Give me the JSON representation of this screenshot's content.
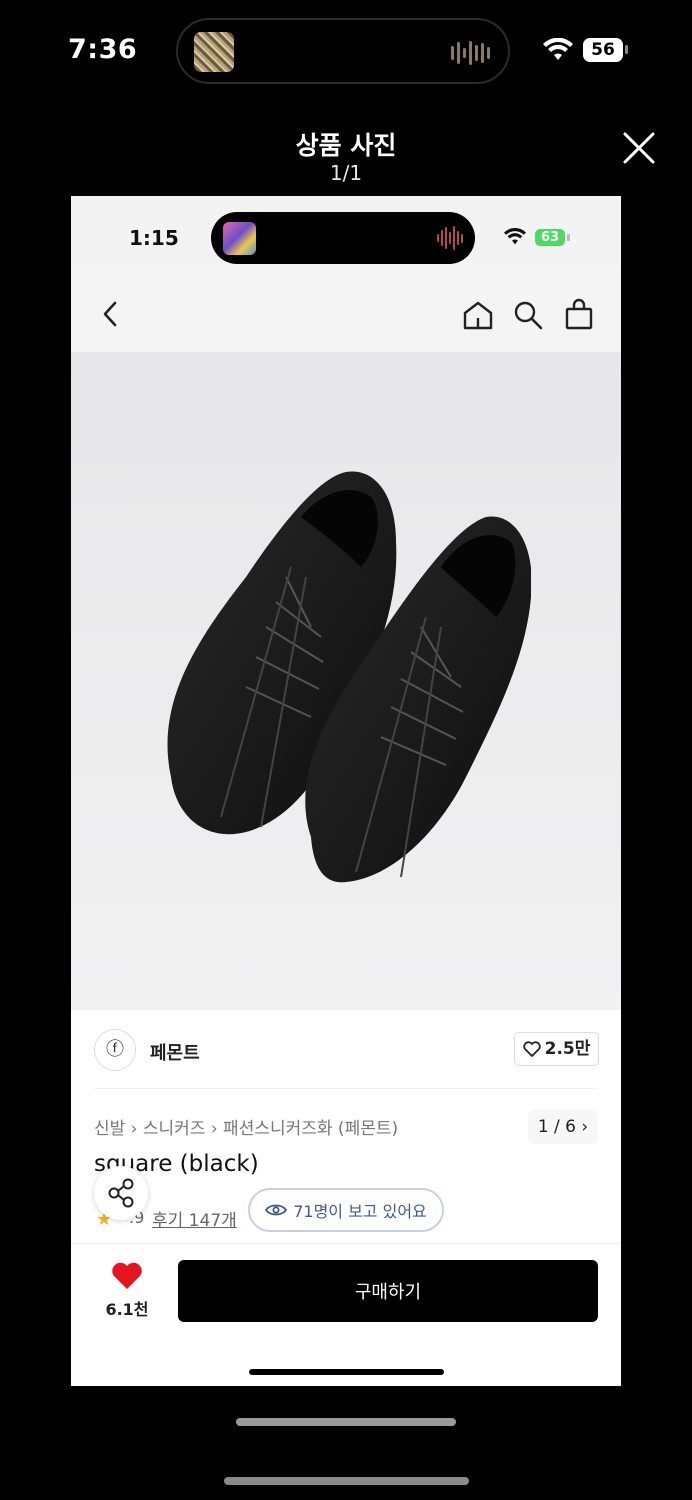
{
  "status_bar": {
    "time": "7:36",
    "battery": "56"
  },
  "viewer": {
    "title": "상품 사진",
    "counter": "1/1"
  },
  "inner": {
    "status_bar": {
      "time": "1:15",
      "battery": "63"
    },
    "gallery": {
      "pager": "1 / 6 ›"
    },
    "brand": {
      "logo_glyph": "ⓕ",
      "name": "페몬트",
      "likes": "2.5만"
    },
    "breadcrumb": "신발 › 스니커즈 › 패션스니커즈화 (페몬트)",
    "product_title": "square (black)",
    "rating": ".9",
    "reviews": "후기 147개",
    "viewing": "71명이 보고 있어요",
    "wishlist_count": "6.1천",
    "buy_label": "구매하기"
  },
  "colors": {
    "accent_heart": "#e5141f",
    "buy_button": "#000000"
  }
}
